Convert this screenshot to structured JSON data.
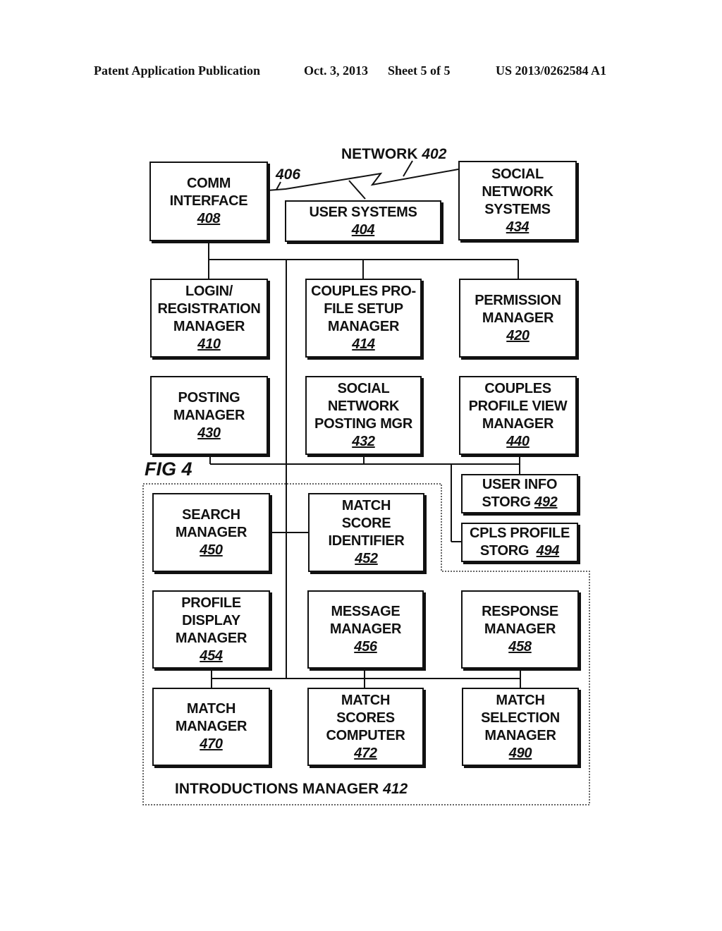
{
  "header": {
    "publication": "Patent Application Publication",
    "date": "Oct. 3, 2013",
    "sheet": "Sheet 5 of 5",
    "number": "US 2013/0262584 A1"
  },
  "figure_label": "FIG 4",
  "network": {
    "label": "NETWORK",
    "ref": "402",
    "link_ref": "406"
  },
  "group": {
    "label": "INTRODUCTIONS MANAGER",
    "ref": "412"
  },
  "boxes": {
    "comm_interface": {
      "lines": [
        "COMM",
        "INTERFACE"
      ],
      "ref": "408"
    },
    "user_systems": {
      "lines": [
        "USER SYSTEMS"
      ],
      "ref": "404"
    },
    "social_network_systems": {
      "lines": [
        "SOCIAL",
        "NETWORK",
        "SYSTEMS"
      ],
      "ref": "434"
    },
    "login_registration": {
      "lines": [
        "LOGIN/",
        "REGISTRATION",
        "MANAGER"
      ],
      "ref": "410"
    },
    "couples_profile_setup": {
      "lines": [
        "COUPLES PRO-",
        "FILE SETUP",
        "MANAGER"
      ],
      "ref": "414"
    },
    "permission_manager": {
      "lines": [
        "PERMISSION",
        "MANAGER"
      ],
      "ref": "420"
    },
    "posting_manager": {
      "lines": [
        "POSTING",
        "MANAGER"
      ],
      "ref": "430"
    },
    "social_network_posting": {
      "lines": [
        "SOCIAL",
        "NETWORK",
        "POSTING MGR"
      ],
      "ref": "432"
    },
    "couples_profile_view": {
      "lines": [
        "COUPLES",
        "PROFILE VIEW",
        "MANAGER"
      ],
      "ref": "440"
    },
    "user_info_storage": {
      "lines": [
        "USER INFO",
        "STORG"
      ],
      "ref": "492"
    },
    "cpls_profile_storage": {
      "lines": [
        "CPLS PROFILE",
        "STORG"
      ],
      "ref": "494"
    },
    "search_manager": {
      "lines": [
        "SEARCH",
        "MANAGER"
      ],
      "ref": "450"
    },
    "match_score_identifier": {
      "lines": [
        "MATCH",
        "SCORE",
        "IDENTIFIER"
      ],
      "ref": "452"
    },
    "profile_display_manager": {
      "lines": [
        "PROFILE",
        "DISPLAY",
        "MANAGER"
      ],
      "ref": "454"
    },
    "message_manager": {
      "lines": [
        "MESSAGE",
        "MANAGER"
      ],
      "ref": "456"
    },
    "response_manager": {
      "lines": [
        "RESPONSE",
        "MANAGER"
      ],
      "ref": "458"
    },
    "match_manager": {
      "lines": [
        "MATCH",
        "MANAGER"
      ],
      "ref": "470"
    },
    "match_scores_computer": {
      "lines": [
        "MATCH",
        "SCORES",
        "COMPUTER"
      ],
      "ref": "472"
    },
    "match_selection_manager": {
      "lines": [
        "MATCH",
        "SELECTION",
        "MANAGER"
      ],
      "ref": "490"
    }
  }
}
